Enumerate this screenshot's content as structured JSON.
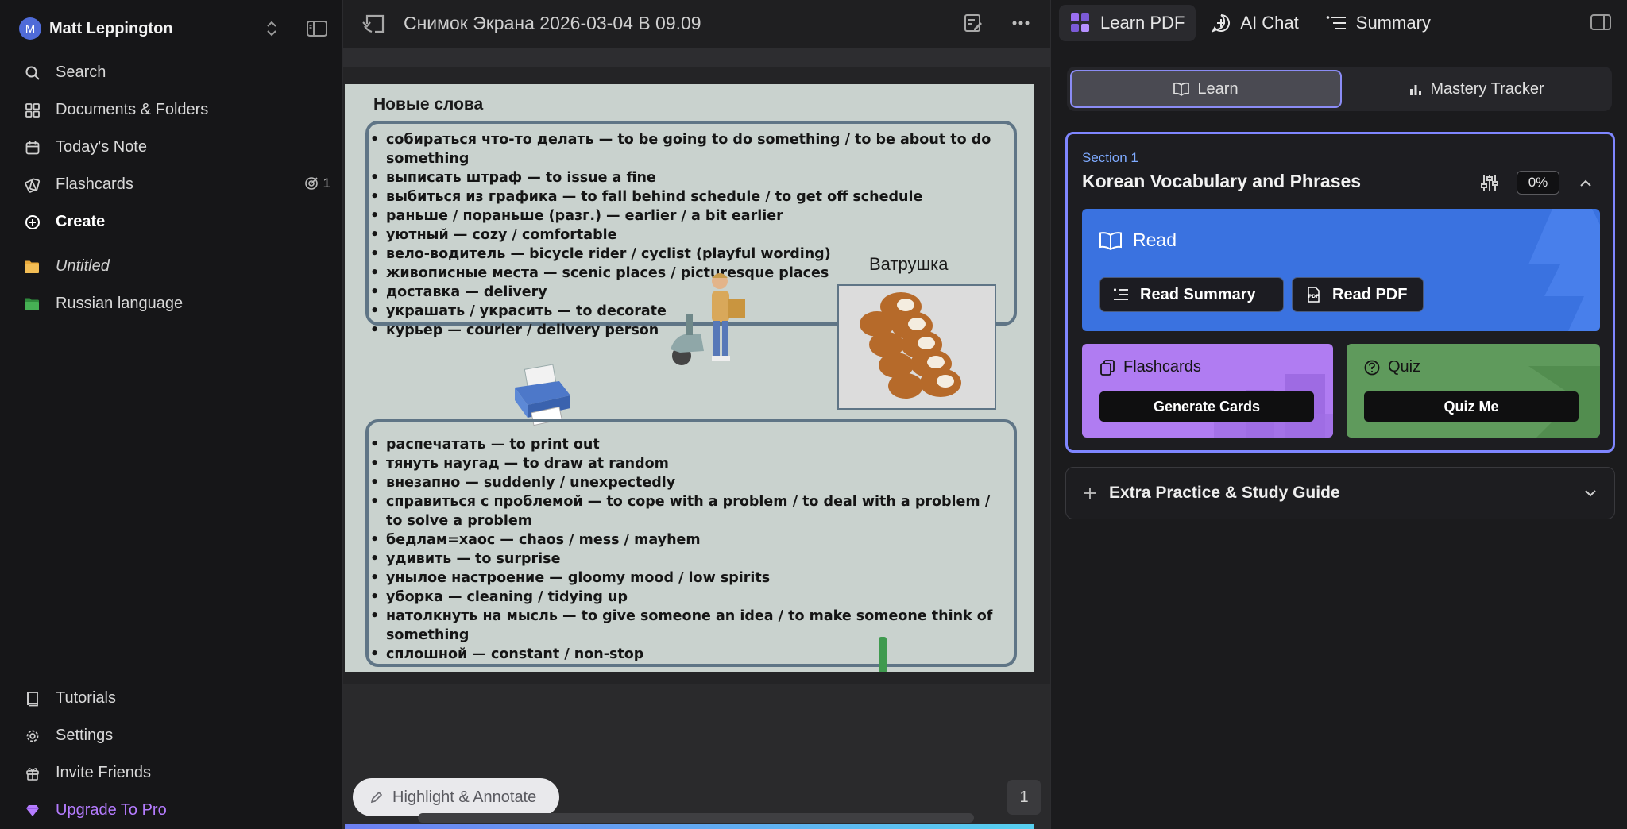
{
  "sidebar": {
    "user": {
      "initial": "M",
      "name": "Matt Leppington"
    },
    "nav": [
      {
        "label": "Search"
      },
      {
        "label": "Documents & Folders"
      },
      {
        "label": "Today's Note"
      },
      {
        "label": "Flashcards",
        "badge": "1"
      },
      {
        "label": "Create"
      }
    ],
    "folders": [
      {
        "label": "Untitled",
        "color": "#e8a93a"
      },
      {
        "label": "Russian language",
        "color": "#3fa34d"
      }
    ],
    "bottom": [
      {
        "label": "Tutorials"
      },
      {
        "label": "Settings"
      },
      {
        "label": "Invite Friends"
      },
      {
        "label": "Upgrade To Pro"
      }
    ]
  },
  "document": {
    "title": "Снимок Экрана 2026-03-04 В 09.09",
    "page": {
      "section_title": "Новые слова",
      "list1": [
        "собираться что-то делать — to be going to do something / to be about to do something",
        "выписать штраф — to issue a fine",
        "выбиться из графика — to fall behind schedule / to get off schedule",
        "раньше / пораньше (разг.) — earlier / a bit earlier",
        "уютный — cozy / comfortable",
        "вело-водитель — bicycle rider / cyclist (playful wording)",
        "живописные места — scenic places / picturesque places",
        "доставка — delivery",
        "украшать / украсить — to decorate",
        "курьер — courier / delivery person"
      ],
      "image_label": "Ватрушка",
      "list2": [
        "распечатать — to print out",
        "тянуть наугад — to draw at random",
        "внезапно — suddenly / unexpectedly",
        "справиться с проблемой — to cope with a problem / to deal with a problem / to solve a problem",
        "бедлам=хаос — chaos / mess / mayhem",
        "удивить — to surprise",
        "унылое настроение — gloomy mood / low spirits",
        "уборка — cleaning / tidying up",
        "натолкнуть на мысль — to give someone an idea / to make someone think of something",
        "сплошной — constant / non-stop"
      ]
    },
    "highlight_label": "Highlight & Annotate",
    "page_number": "1"
  },
  "panel": {
    "tabs": [
      {
        "label": "Learn PDF"
      },
      {
        "label": "AI Chat"
      },
      {
        "label": "Summary"
      }
    ],
    "segments": {
      "learn": "Learn",
      "mastery": "Mastery Tracker"
    },
    "section": {
      "label": "Section 1",
      "title": "Korean Vocabulary and Phrases",
      "progress": "0%",
      "read_title": "Read",
      "read_summary": "Read Summary",
      "read_pdf": "Read PDF",
      "flashcards_title": "Flashcards",
      "flashcards_btn": "Generate Cards",
      "quiz_title": "Quiz",
      "quiz_btn": "Quiz Me"
    },
    "extra_label": "Extra Practice & Study Guide"
  },
  "colors": {
    "accent": "#7f86ff",
    "read_card": "#3a72e0",
    "flashcards_card": "#b07cf2",
    "quiz_card": "#5f9a5c",
    "pro": "#b57cff"
  }
}
